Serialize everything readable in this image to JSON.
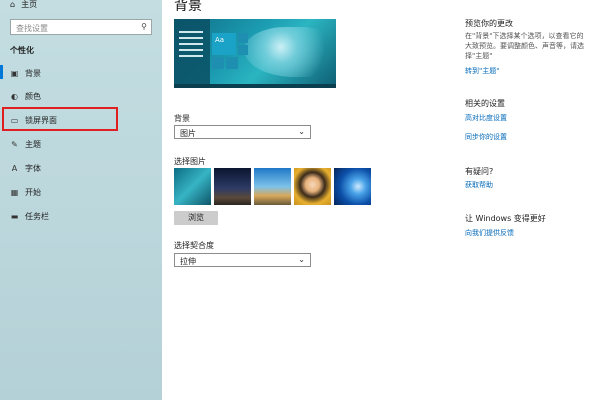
{
  "sidebar": {
    "home_label": "主页",
    "search_placeholder": "查找设置",
    "section_title": "个性化",
    "items": [
      {
        "label": "背景",
        "icon": "picture-icon"
      },
      {
        "label": "颜色",
        "icon": "palette-icon"
      },
      {
        "label": "锁屏界面",
        "icon": "lock-screen-icon"
      },
      {
        "label": "主题",
        "icon": "brush-icon"
      },
      {
        "label": "字体",
        "icon": "font-icon"
      },
      {
        "label": "开始",
        "icon": "start-icon"
      },
      {
        "label": "任务栏",
        "icon": "taskbar-icon"
      }
    ]
  },
  "main": {
    "title": "背景",
    "preview_tile_label": "Aa",
    "background_label": "背景",
    "background_value": "图片",
    "choose_picture_label": "选择图片",
    "browse_label": "浏览",
    "fit_label": "选择契合度",
    "fit_value": "拉伸"
  },
  "right": {
    "preview_heading": "预览你的更改",
    "preview_text": "在\"背景\"下选择某个选项，以查看它的大致预览。要调整颜色、声音等，请选择\"主题\"",
    "preview_link": "转到\"主题\"",
    "related_heading": "相关的设置",
    "related_links": [
      "高对比度设置",
      "同步你的设置"
    ],
    "question_heading": "有疑问?",
    "question_link": "获取帮助",
    "feedback_heading": "让 Windows 变得更好",
    "feedback_link": "向我们提供反馈"
  },
  "colors": {
    "accent": "#0078d7",
    "highlight_box": "#e02020",
    "link": "#0068b8"
  }
}
